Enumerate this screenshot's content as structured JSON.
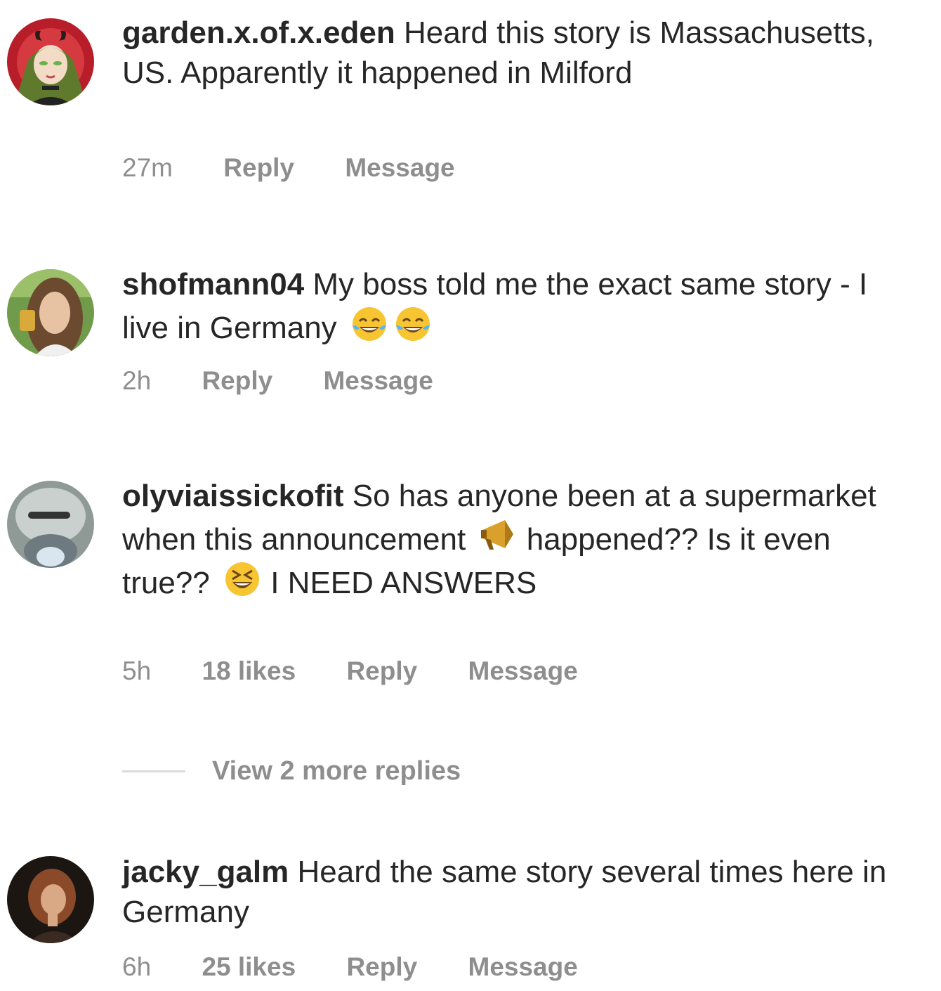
{
  "comments": [
    {
      "username": "garden.x.of.x.eden",
      "text": "Heard this story is Massachusetts, US. Apparently it happened in Milford",
      "time": "27m",
      "likes": "",
      "reply_label": "Reply",
      "message_label": "Message"
    },
    {
      "username": "shofmann04",
      "text": "My boss told me the exact same story - I live in Germany",
      "emojis": [
        "tears-of-joy-emoji",
        "tears-of-joy-emoji"
      ],
      "time": "2h",
      "likes": "",
      "reply_label": "Reply",
      "message_label": "Message"
    },
    {
      "username": "olyviaissickofit",
      "text_part1": "So has anyone been at a supermarket when this announcement",
      "text_part2": "happened?? Is it even true??",
      "text_part3": "I NEED ANSWERS",
      "emojis": [
        "megaphone-emoji",
        "laughing-squint-emoji"
      ],
      "time": "5h",
      "likes": "18 likes",
      "reply_label": "Reply",
      "message_label": "Message"
    },
    {
      "username": "jacky_galm",
      "text": "Heard the same story several times here in Germany",
      "time": "6h",
      "likes": "25 likes",
      "reply_label": "Reply",
      "message_label": "Message"
    }
  ],
  "view_more_replies": "View 2 more replies",
  "colors": {
    "text": "#262626",
    "secondary": "#8e8e8e",
    "divider": "#dbdbdb"
  }
}
